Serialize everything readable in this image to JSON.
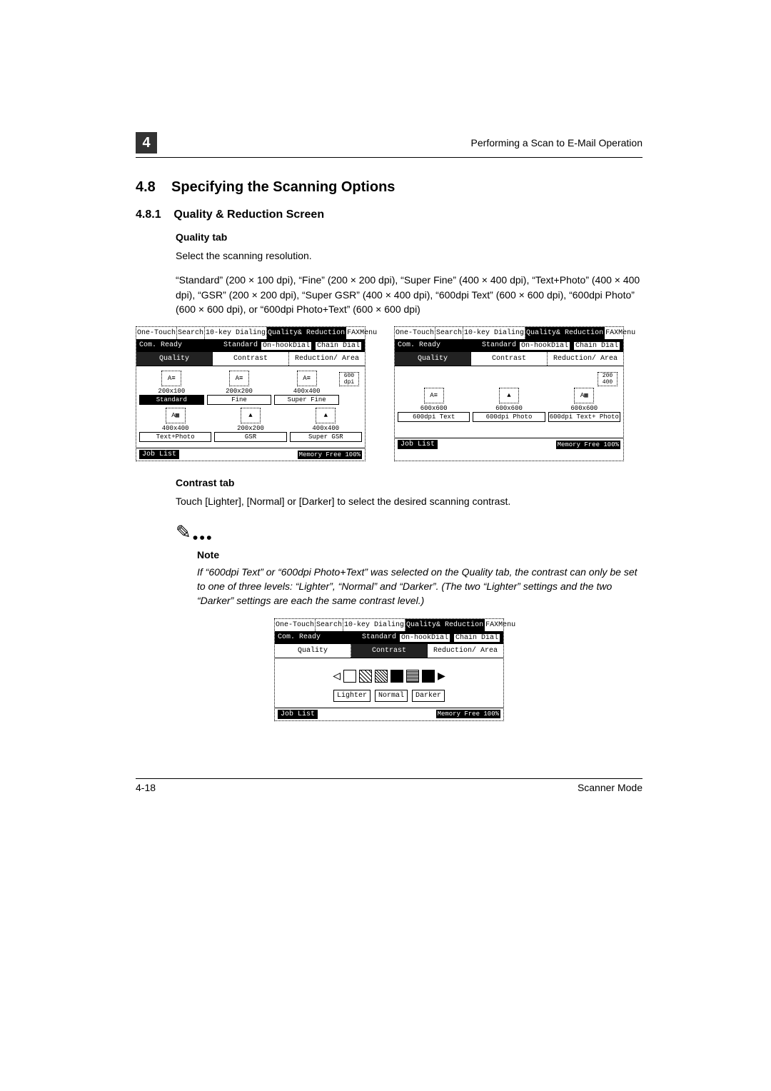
{
  "chapter_number": "4",
  "running_head": "Performing a Scan to E-Mail Operation",
  "section": {
    "number": "4.8",
    "title": "Specifying the Scanning Options"
  },
  "subsection": {
    "number": "4.8.1",
    "title": "Quality & Reduction Screen"
  },
  "quality_heading": "Quality tab",
  "quality_intro": "Select the scanning resolution.",
  "quality_paragraph": "“Standard” (200 × 100 dpi), “Fine” (200 × 200 dpi), “Super Fine” (400 × 400 dpi), “Text+Photo” (400 × 400 dpi), “GSR” (200 × 200 dpi), “Super GSR” (400 × 400 dpi), “600dpi Text” (600 × 600 dpi), “600dpi Photo” (600 × 600 dpi), or “600dpi Photo+Text” (600 × 600 dpi)",
  "tabs": {
    "one_touch": "One-Touch",
    "search": "Search",
    "ten_key": "10-key Dialing",
    "quality": "Quality& Reduction",
    "fax_menu": "FAXMenu"
  },
  "status": {
    "ready": "Com. Ready",
    "standard": "Standard",
    "onhook": "On-hookDial",
    "chain": "Chain Dial"
  },
  "subtabs": {
    "quality": "Quality",
    "contrast": "Contrast",
    "reduction": "Reduction/ Area"
  },
  "quality_screen_left": {
    "row1": [
      {
        "sub": "200x100",
        "label": "Standard",
        "active": true
      },
      {
        "sub": "200x200",
        "label": "Fine"
      },
      {
        "sub": "400x400",
        "label": "Super Fine"
      }
    ],
    "row2": [
      {
        "sub": "400x400",
        "label": "Text+Photo"
      },
      {
        "sub": "200x200",
        "label": "GSR"
      },
      {
        "sub": "400x400",
        "label": "Super GSR"
      }
    ],
    "extra": "600 dpi"
  },
  "quality_screen_right": {
    "row1": [
      {
        "sub": "600x600",
        "label": "600dpi Text"
      },
      {
        "sub": "600x600",
        "label": "600dpi Photo"
      },
      {
        "sub": "600x600",
        "label": "600dpi Text+ Photo"
      }
    ],
    "extra": "200 400"
  },
  "footer": {
    "job_list": "Job List",
    "memory": "Memory Free 100%"
  },
  "contrast_heading": "Contrast tab",
  "contrast_paragraph": "Touch [Lighter], [Normal] or [Darker] to select the desired scanning contrast.",
  "note": {
    "label": "Note",
    "text": "If “600dpi Text” or “600dpi Photo+Text” was selected on the Quality tab, the contrast can only be set to one of three levels: “Lighter”, “Normal” and “Darker”. (The two “Lighter” settings and the two “Darker” settings are each the same contrast level.)"
  },
  "contrast_buttons": {
    "lighter": "Lighter",
    "normal": "Normal",
    "darker": "Darker"
  },
  "page_footer": {
    "left": "4-18",
    "right": "Scanner Mode"
  }
}
